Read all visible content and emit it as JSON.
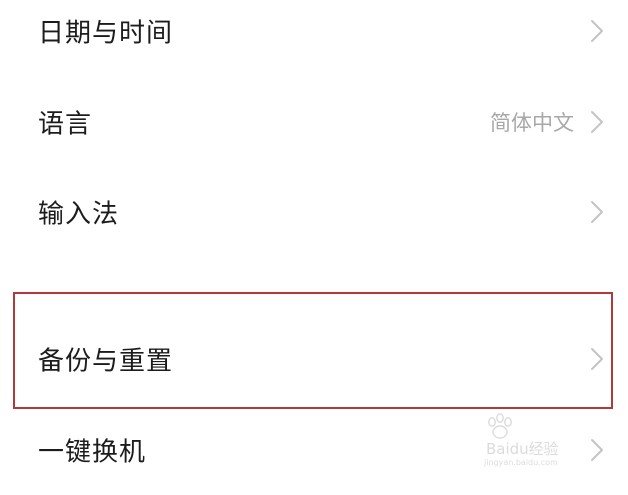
{
  "settings": {
    "items": [
      {
        "label": "日期与时间",
        "value": ""
      },
      {
        "label": "语言",
        "value": "简体中文"
      },
      {
        "label": "输入法",
        "value": ""
      },
      {
        "label": "备份与重置",
        "value": ""
      },
      {
        "label": "一键换机",
        "value": ""
      }
    ]
  },
  "highlight": {
    "target": "备份与重置",
    "color": "#b03a3a"
  },
  "watermark": {
    "brand": "Baidu经验",
    "url": "jingyan.baidu.com"
  },
  "icons": {
    "chevron": "chevron-right-icon",
    "watermark": "baidu-paw-logo"
  },
  "colors": {
    "text": "#1c1c1c",
    "secondary": "#a8a8a8",
    "chevron": "#c4c4c4"
  }
}
